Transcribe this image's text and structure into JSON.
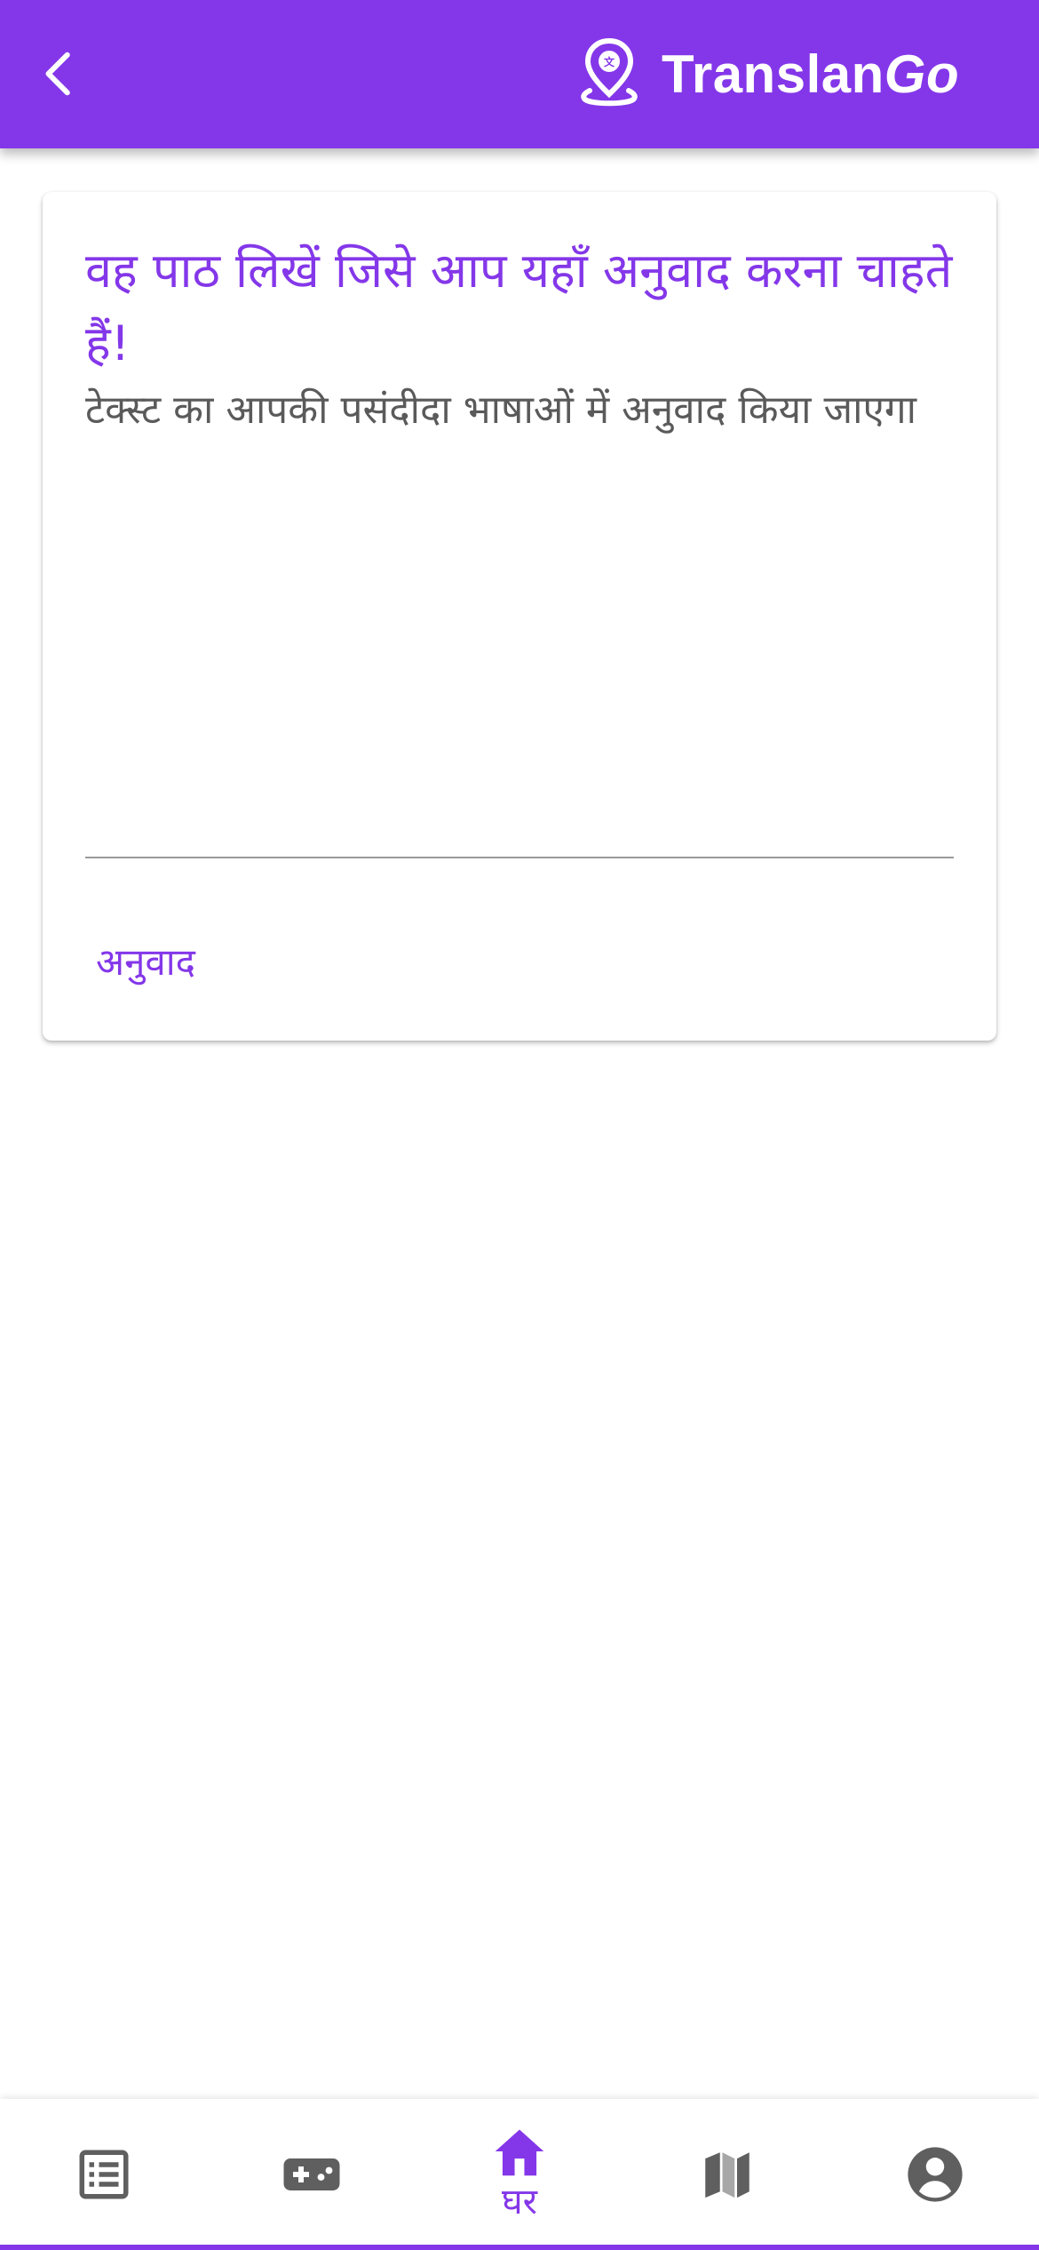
{
  "app_bar": {
    "brand_prefix": "Translan",
    "brand_suffix": "Go",
    "back_icon": "chevron-left-icon",
    "logo_icon": "location-translate-icon",
    "background_color": "#8437E9"
  },
  "card": {
    "title": "वह पाठ लिखें जिसे आप यहाँ अनुवाद करना चाहते हैं!",
    "subtitle": "टेक्स्ट का आपकी पसंदीदा भाषाओं में अनुवाद किया जाएगा",
    "input_value": "",
    "translate_label": "अनुवाद"
  },
  "bottom_nav": {
    "items": [
      {
        "icon": "list-icon",
        "label": "",
        "active": false
      },
      {
        "icon": "gamepad-icon",
        "label": "",
        "active": false
      },
      {
        "icon": "home-icon",
        "label": "घर",
        "active": true
      },
      {
        "icon": "map-icon",
        "label": "",
        "active": false
      },
      {
        "icon": "account-circle-icon",
        "label": "",
        "active": false
      }
    ],
    "active_color": "#8437E9",
    "inactive_color": "#5f5f5f"
  }
}
